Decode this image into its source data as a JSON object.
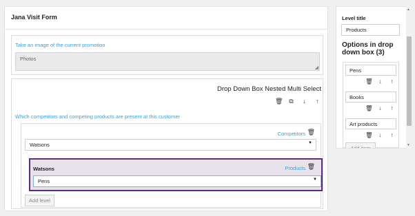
{
  "form": {
    "title": "Jana Visit Form",
    "photo_prompt": "Take an image of the current promotion",
    "photo_placeholder": "Photos",
    "dropdown_title": "Drop Down Box Nested Multi Select",
    "dropdown_prompt": "Which competitors and competing products are present at this customer",
    "levels": [
      {
        "label": "Competitors",
        "selected": "Watsons"
      },
      {
        "heading": "Watsons",
        "label": "Products",
        "selected": "Pens"
      }
    ],
    "add_level": "Add level"
  },
  "side": {
    "level_title_label": "Level title",
    "level_title_value": "Products",
    "options_heading": "Options in drop down box (3)",
    "options": [
      "Pens",
      "Books",
      "Art products"
    ],
    "add_item": "Add item"
  },
  "icons": {
    "delete": "trash-icon",
    "copy": "copy-icon",
    "down": "arrow-down-icon",
    "up": "arrow-up-icon",
    "caret": "caret-down-icon"
  },
  "colors": {
    "accent_label": "#3a9fd6",
    "selected_border": "#5a2d7e",
    "selected_bg": "#e7e1ea"
  }
}
